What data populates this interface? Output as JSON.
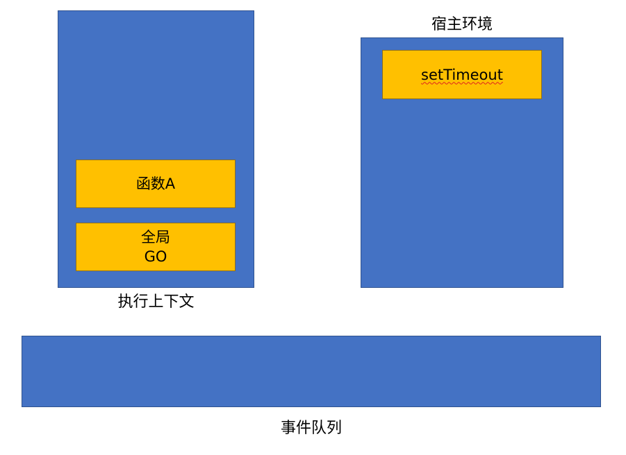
{
  "execution_context": {
    "caption": "执行上下文",
    "function_block": "函数A",
    "global_block": {
      "line1": "全局",
      "line2": "GO"
    }
  },
  "host_environment": {
    "caption": "宿主环境",
    "timer_block": "setTimeout"
  },
  "event_queue": {
    "caption": "事件队列"
  },
  "colors": {
    "panel": "#4472c4",
    "block": "#ffc000"
  }
}
